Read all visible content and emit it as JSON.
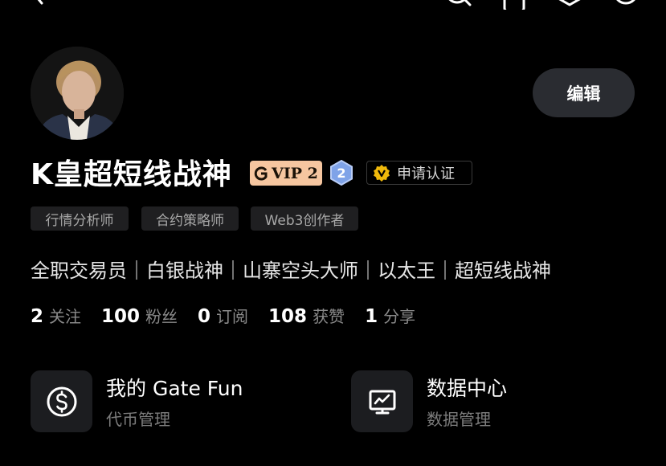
{
  "header": {
    "icons": [
      "back-icon",
      "search-icon",
      "bookmark-icon",
      "settings-icon",
      "share-icon"
    ]
  },
  "profile": {
    "name": "K皇超短线战神",
    "vip_label": "VIP 2",
    "level": "2",
    "certify_label": "申请认证",
    "edit_label": "编辑",
    "tags": [
      "行情分析师",
      "合约策略师",
      "Web3创作者"
    ],
    "bio": "全职交易员｜白银战神｜山寨空头大师｜以太王｜超短线战神"
  },
  "stats": [
    {
      "num": "2",
      "label": "关注"
    },
    {
      "num": "100",
      "label": "粉丝"
    },
    {
      "num": "0",
      "label": "订阅"
    },
    {
      "num": "108",
      "label": "获赞"
    },
    {
      "num": "1",
      "label": "分享"
    }
  ],
  "cards": [
    {
      "title": "我的 Gate Fun",
      "subtitle": "代币管理",
      "icon": "dollar-coin-icon"
    },
    {
      "title": "数据中心",
      "subtitle": "数据管理",
      "icon": "chart-monitor-icon"
    }
  ],
  "colors": {
    "background": "#000000",
    "vip_bg": "#f6c6a0",
    "badge_blue": "#7fa3e8",
    "verify_gold": "#f0b90b"
  }
}
